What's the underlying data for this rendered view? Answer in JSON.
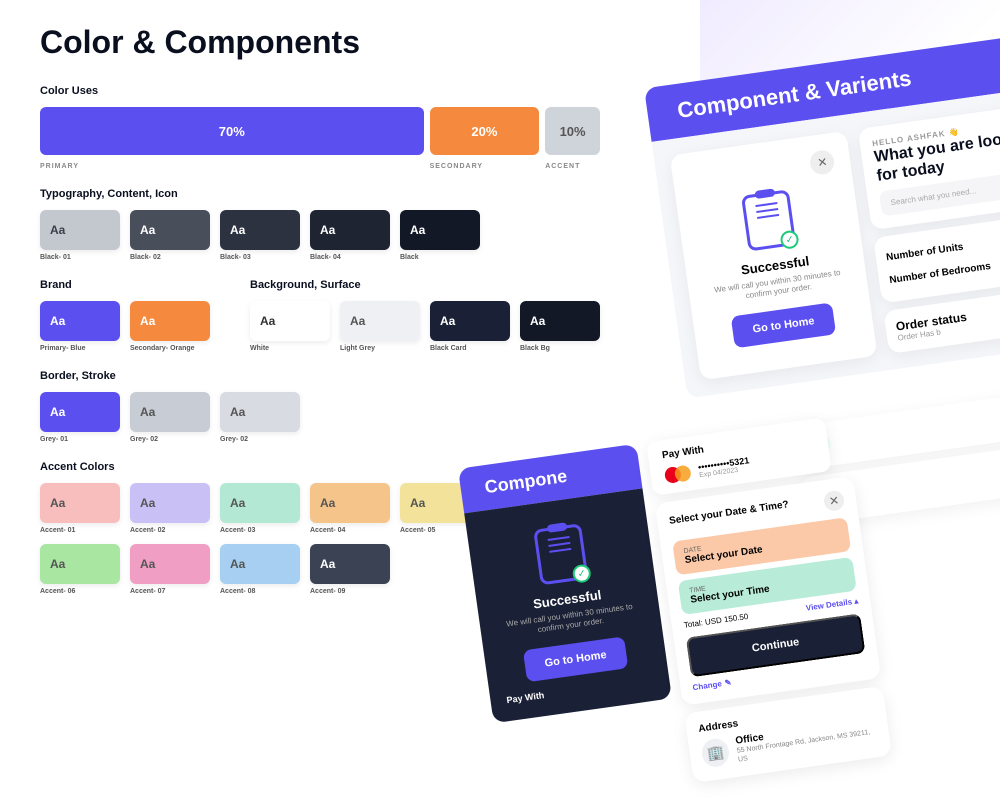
{
  "title": "Color & Components",
  "color_uses": {
    "label": "Color Uses",
    "primary": {
      "pct": "70%",
      "label": "PRIMARY",
      "color": "#5c4ff0"
    },
    "secondary": {
      "pct": "20%",
      "label": "SECONDARY",
      "color": "#f5893d"
    },
    "accent": {
      "pct": "10%",
      "label": "ACCENT",
      "color": "#cfd3da"
    }
  },
  "typography": {
    "label": "Typography, Content, Icon",
    "swatches": [
      {
        "text": "Aa",
        "bg": "#c3c7ce",
        "fg": "#3a3f4b",
        "label": "Black- 01"
      },
      {
        "text": "Aa",
        "bg": "#494e5b",
        "fg": "#fff",
        "label": "Black- 02"
      },
      {
        "text": "Aa",
        "bg": "#2d3240",
        "fg": "#fff",
        "label": "Black- 03"
      },
      {
        "text": "Aa",
        "bg": "#1f2432",
        "fg": "#fff",
        "label": "Black- 04"
      },
      {
        "text": "Aa",
        "bg": "#131826",
        "fg": "#fff",
        "label": "Black"
      }
    ]
  },
  "brand": {
    "label": "Brand",
    "swatches": [
      {
        "text": "Aa",
        "bg": "#5c4ff0",
        "fg": "#fff",
        "label": "Primary- Blue"
      },
      {
        "text": "Aa",
        "bg": "#f5893d",
        "fg": "#fff",
        "label": "Secondary- Orange"
      }
    ]
  },
  "background": {
    "label": "Background, Surface",
    "swatches": [
      {
        "text": "Aa",
        "bg": "#ffffff",
        "fg": "#333",
        "label": "White"
      },
      {
        "text": "Aa",
        "bg": "#eef0f4",
        "fg": "#555",
        "label": "Light Grey"
      },
      {
        "text": "Aa",
        "bg": "#1a2035",
        "fg": "#fff",
        "label": "Black Card"
      },
      {
        "text": "Aa",
        "bg": "#131826",
        "fg": "#fff",
        "label": "Black Bg"
      }
    ]
  },
  "border": {
    "label": "Border, Stroke",
    "swatches": [
      {
        "text": "Aa",
        "bg": "#5c4ff0",
        "fg": "#fff",
        "label": "Grey- 01"
      },
      {
        "text": "Aa",
        "bg": "#c8ccd4",
        "fg": "#555",
        "label": "Grey- 02"
      },
      {
        "text": "Aa",
        "bg": "#d8dbe2",
        "fg": "#555",
        "label": "Grey- 02"
      }
    ]
  },
  "accent": {
    "label": "Accent Colors",
    "swatches": [
      {
        "text": "Aa",
        "bg": "#f8bdbd",
        "fg": "#555",
        "label": "Accent- 01"
      },
      {
        "text": "Aa",
        "bg": "#c9c0f5",
        "fg": "#555",
        "label": "Accent- 02"
      },
      {
        "text": "Aa",
        "bg": "#b3e8d4",
        "fg": "#555",
        "label": "Accent- 03"
      },
      {
        "text": "Aa",
        "bg": "#f5c48a",
        "fg": "#555",
        "label": "Accent- 04"
      },
      {
        "text": "Aa",
        "bg": "#f3e39a",
        "fg": "#555",
        "label": "Accent- 05"
      },
      {
        "text": "Aa",
        "bg": "#a9e6a2",
        "fg": "#555",
        "label": "Accent- 06"
      },
      {
        "text": "Aa",
        "bg": "#f19ec5",
        "fg": "#555",
        "label": "Accent- 07"
      },
      {
        "text": "Aa",
        "bg": "#a6cff2",
        "fg": "#555",
        "label": "Accent- 08"
      },
      {
        "text": "Aa",
        "bg": "#3a4254",
        "fg": "#fff",
        "label": "Accent- 09"
      }
    ]
  },
  "variants": {
    "title": "Component & Varients",
    "success": {
      "title": "Successful",
      "sub": "We will call you within 30 minutes to confirm your order.",
      "cta": "Go to Home"
    },
    "hello": "HELLO ASHFAK 👋",
    "search_title": "What you are looking for today",
    "search_placeholder": "Search what you need...",
    "units": "Number of Units",
    "bedrooms": "Number of Bedrooms",
    "order_status": "Order status",
    "order_sub": "Order  Has b",
    "change": "Change",
    "pay": {
      "title": "Pay With",
      "card": "••••••••••5321",
      "exp": "Exp 04/2023"
    },
    "date_time": {
      "title": "Select your Date & Time?",
      "date_lbl": "DATE",
      "date_val": "Select your Date",
      "time_lbl": "TIME",
      "time_val": "Select your Time",
      "total": "Total: USD 150.50",
      "view": "View Details ▴",
      "continue": "Continue"
    },
    "address": {
      "title": "Address",
      "name": "Office",
      "text": "55 North Frontage Rd, Jackson, MS 39211, US"
    },
    "compone": "Compone",
    "pay_with_dark": "Pay With"
  }
}
